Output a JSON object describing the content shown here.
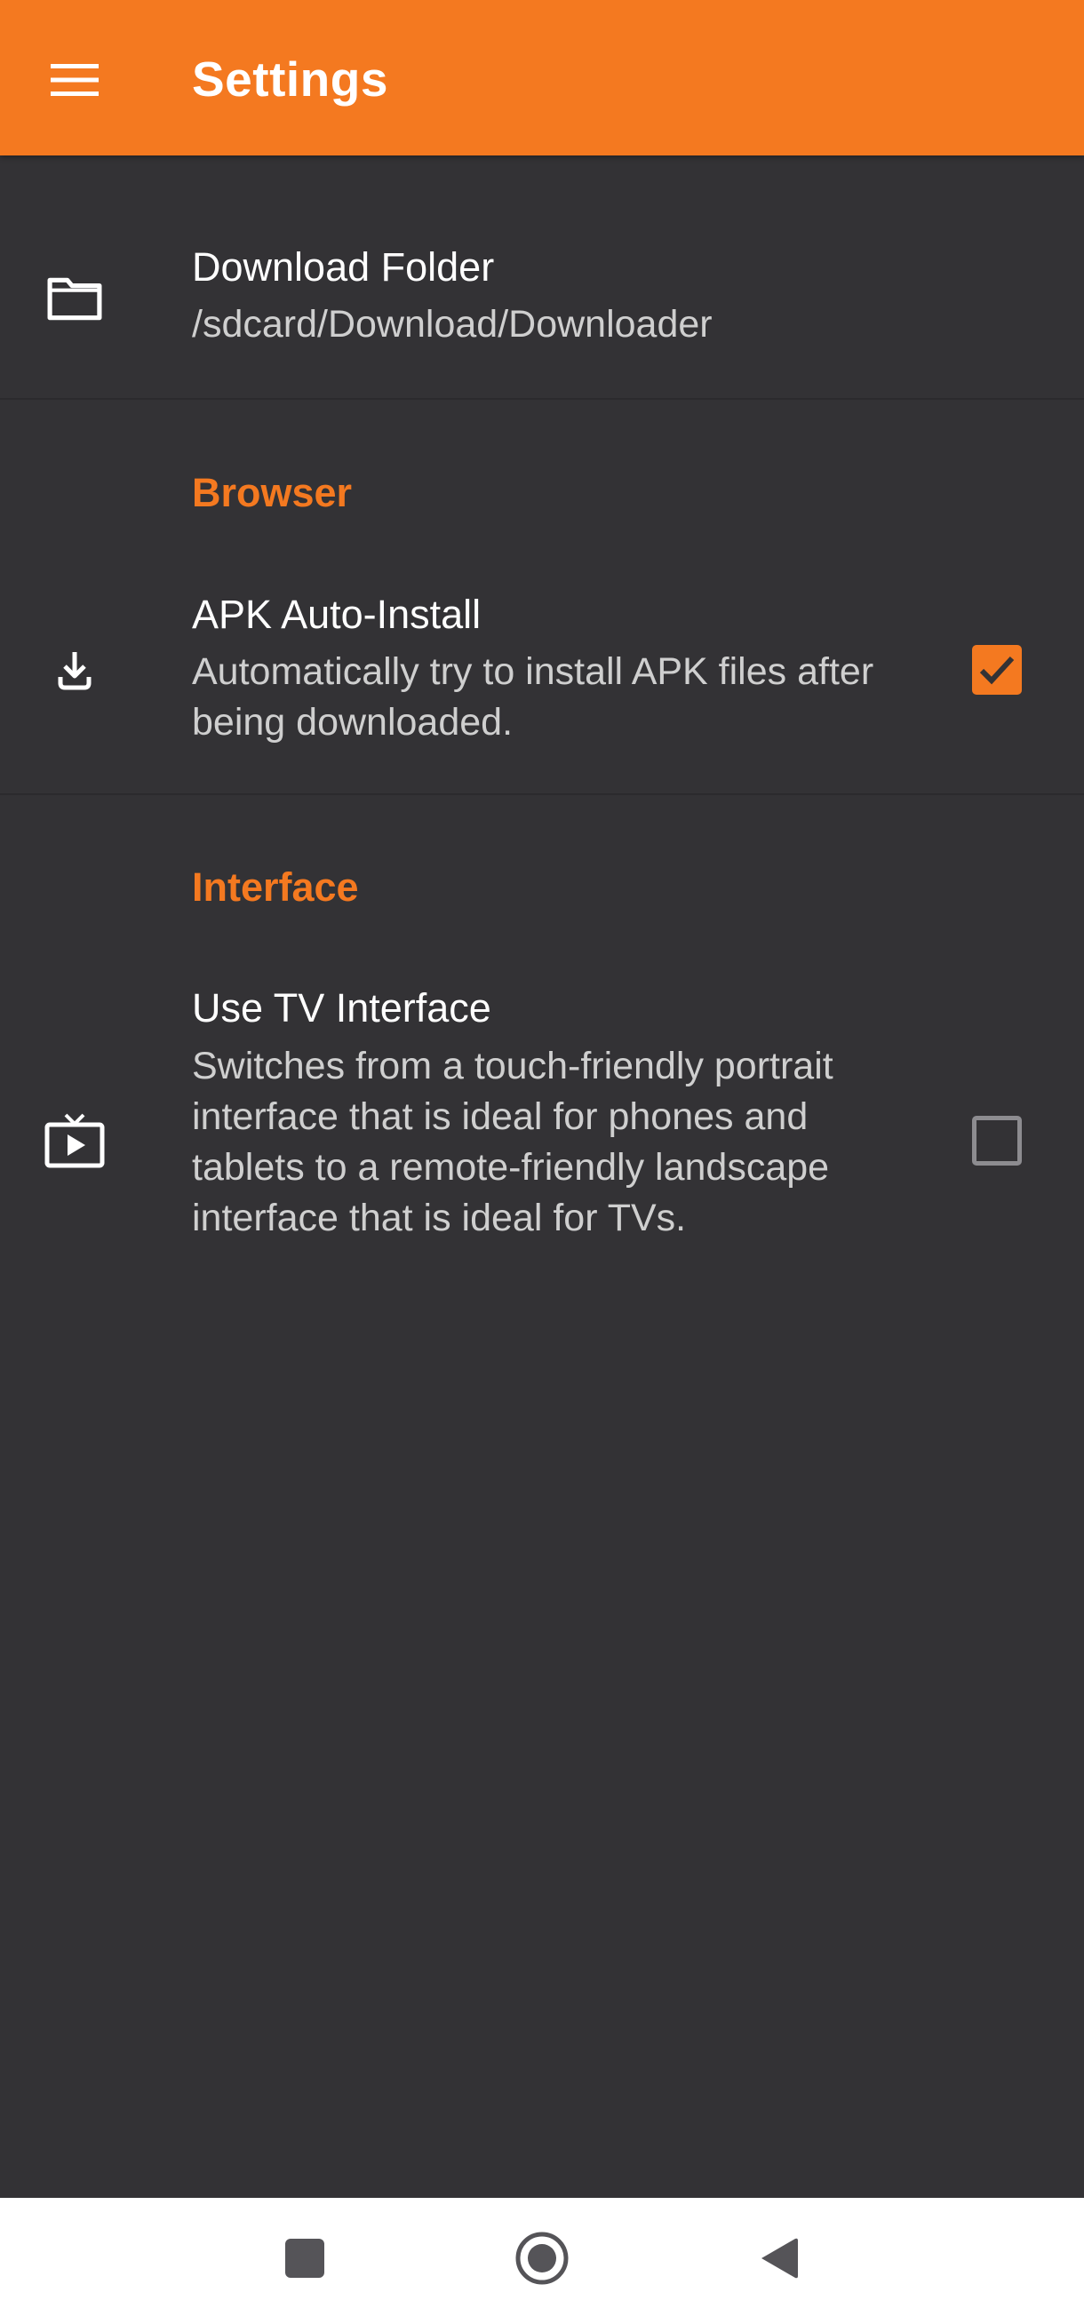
{
  "appbar": {
    "title": "Settings",
    "menu_icon": "hamburger-menu-icon",
    "color": "#f47920"
  },
  "download_folder": {
    "icon": "folder-icon",
    "title": "Download Folder",
    "path": "/sdcard/Download/Downloader"
  },
  "sections": {
    "browser": {
      "header": "Browser",
      "apk_auto_install": {
        "icon": "download-icon",
        "title": "APK Auto-Install",
        "summary": "Automatically try to install APK files after being downloaded.",
        "checked": true
      }
    },
    "interface": {
      "header": "Interface",
      "use_tv_interface": {
        "icon": "tv-play-icon",
        "title": "Use TV Interface",
        "summary": "Switches from a touch-friendly portrait interface that is ideal for phones and tablets to a remote-friendly landscape interface that is ideal for TVs.",
        "checked": false
      }
    }
  },
  "navbar": {
    "buttons": [
      "recents-square-icon",
      "home-circle-icon",
      "back-triangle-icon"
    ]
  },
  "colors": {
    "accent": "#f47920",
    "background": "#333235",
    "navbar": "#ffffff"
  }
}
